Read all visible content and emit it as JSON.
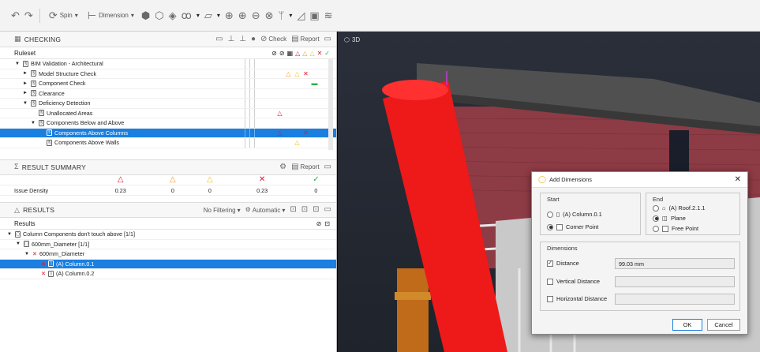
{
  "toolbar": {
    "spin_label": "Spin",
    "dimension_label": "Dimension"
  },
  "checking": {
    "title": "CHECKING",
    "check_label": "Check",
    "report_label": "Report",
    "ruleset_header": "Ruleset",
    "rows": [
      {
        "label": "BIM Validation - Architectural",
        "indent": 0,
        "caret": "▼",
        "marks": []
      },
      {
        "label": "Model Structure Check",
        "indent": 1,
        "caret": "►",
        "marks": [
          "",
          "",
          "tri-orange",
          "tri-yellow",
          "x-red"
        ]
      },
      {
        "label": "Component Check",
        "indent": 1,
        "caret": "►",
        "marks": [
          "",
          "",
          "",
          "",
          "",
          "chk-green"
        ]
      },
      {
        "label": "Clearance",
        "indent": 1,
        "caret": "►",
        "marks": []
      },
      {
        "label": "Deficiency Detection",
        "indent": 1,
        "caret": "▼",
        "marks": []
      },
      {
        "label": "Unallocated Areas",
        "indent": 2,
        "caret": "",
        "marks": [
          "",
          "tri-red"
        ]
      },
      {
        "label": "Components Below and Above",
        "indent": 2,
        "caret": "▼",
        "marks": []
      },
      {
        "label": "Components Above Columns",
        "indent": 3,
        "caret": "",
        "marks": [
          "",
          "tri-red",
          "",
          "",
          "x-red"
        ],
        "selected": true
      },
      {
        "label": "Components Above Walls",
        "indent": 3,
        "caret": "",
        "marks": [
          "",
          "",
          "",
          "tri-yellow"
        ]
      }
    ]
  },
  "summary": {
    "title": "RESULT SUMMARY",
    "report_label": "Report",
    "row_label": "Issue Density",
    "values": [
      "0.23",
      "0",
      "0",
      "0.23",
      "0"
    ]
  },
  "results": {
    "title": "RESULTS",
    "filter_label": "No Filtering",
    "auto_label": "Automatic",
    "header": "Results",
    "rows": [
      {
        "label": "Column Components don't touch above [1/1]",
        "indent": 0
      },
      {
        "label": "600mm_Diameter [1/1]",
        "indent": 1
      },
      {
        "label": "600mm_Diameter",
        "indent": 2
      },
      {
        "label": "(A) Column.0.1",
        "indent": 3,
        "selected": true
      },
      {
        "label": "(A) Column.0.2",
        "indent": 3
      }
    ]
  },
  "viewport": {
    "label": "3D"
  },
  "dialog": {
    "title": "Add Dimensions",
    "start_title": "Start",
    "end_title": "End",
    "start_opt1": "(A) Column.0.1",
    "start_opt2": "Corner Point",
    "end_opt1": "(A) Roof.2.1.1",
    "end_opt2": "Plane",
    "end_opt3": "Free Point",
    "dims_title": "Dimensions",
    "distance_label": "Distance",
    "distance_value": "99.03 mm",
    "vertical_label": "Vertical Distance",
    "horizontal_label": "Horizontal Distance",
    "ok_label": "OK",
    "cancel_label": "Cancel"
  }
}
